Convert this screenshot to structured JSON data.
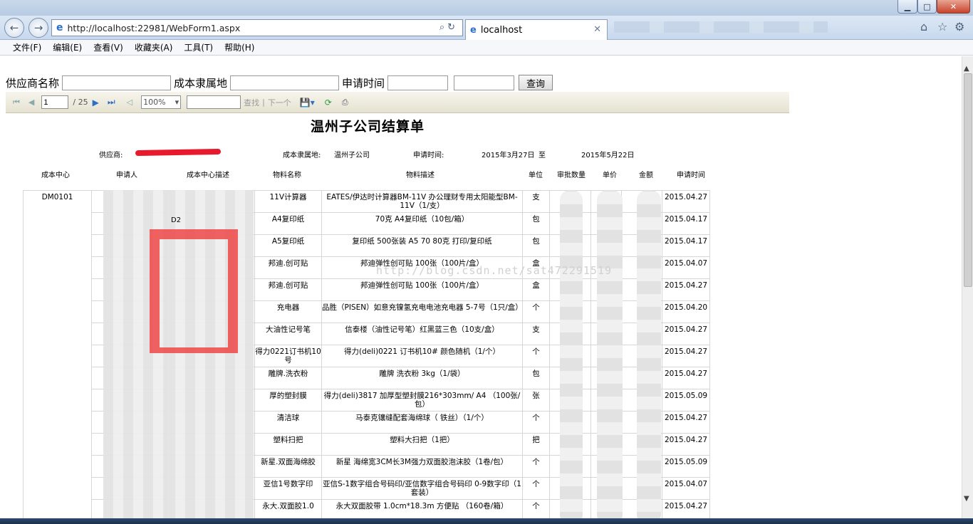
{
  "browser": {
    "address": "http://localhost:22981/WebForm1.aspx",
    "tab_title": "localhost"
  },
  "menu": [
    "文件(F)",
    "编辑(E)",
    "查看(V)",
    "收藏夹(A)",
    "工具(T)",
    "帮助(H)"
  ],
  "search": {
    "supplier_label": "供应商名称",
    "cost_label": "成本隶属地",
    "date_label": "申请时间",
    "query_label": "查询"
  },
  "report_toolbar": {
    "page_value": "1",
    "page_total": "/ 25",
    "zoom": "100%",
    "find_label": "查找",
    "separator": "|",
    "next_label": "下一个"
  },
  "report": {
    "title": "温州子公司结算单",
    "supplier_label": "供应商:",
    "cost_label": "成本隶属地:",
    "cost_value": "温州子公司",
    "date_label": "申请时间:",
    "date_from": "2015年3月27日",
    "date_sep": "至",
    "date_to": "2015年5月22日",
    "columns": [
      "成本中心",
      "申请人",
      "成本中心描述",
      "物料名称",
      "物料描述",
      "单位",
      "审批数量",
      "单价",
      "金额",
      "申请时间"
    ],
    "cost_center": "DM0101",
    "fragment_d2": "D2",
    "rows": [
      {
        "name": "11V计算器",
        "desc": "EATES/伊达时计算器BM-11V 办公理财专用太阳能型BM-11V（1/支）",
        "unit": "支",
        "date": "2015.04.27"
      },
      {
        "name": "A4复印纸",
        "desc": "70克 A4复印纸（10包/箱）",
        "unit": "包",
        "date": "2015.04.17"
      },
      {
        "name": "A5复印纸",
        "desc": "复印纸 500张装 A5 70 80克 打印/复印纸",
        "unit": "包",
        "date": "2015.04.17"
      },
      {
        "name": "邦迪.创可贴",
        "desc": "邦迪弹性创可贴 100张（100片/盒）",
        "unit": "盒",
        "date": "2015.04.07"
      },
      {
        "name": "邦迪.创可贴",
        "desc": "邦迪弹性创可贴 100张（100片/盒）",
        "unit": "盒",
        "date": "2015.04.27"
      },
      {
        "name": "充电器",
        "desc": "品胜（PISEN）如意充镍氢充电电池充电器 5-7号（1只/盒）",
        "unit": "个",
        "date": "2015.04.20"
      },
      {
        "name": "大油性记号笔",
        "desc": "信泰楼（油性记号笔）红黑蓝三色（10支/盒）",
        "unit": "支",
        "date": "2015.04.27"
      },
      {
        "name": "得力0221订书机10号",
        "desc": "得力(deli)0221 订书机10# 颜色随机（1/个）",
        "unit": "个",
        "date": "2015.04.27"
      },
      {
        "name": "雕牌.洗衣粉",
        "desc": "雕牌 洗衣粉 3kg（1/袋）",
        "unit": "包",
        "date": "2015.04.27"
      },
      {
        "name": "厚的塑封膜",
        "desc": "得力(deli)3817 加厚型塑封膜216*303mm/ A4 （100张/包）",
        "unit": "张",
        "date": "2015.05.09"
      },
      {
        "name": "清洁球",
        "desc": "马泰克镶缝配套海绵球（ 铁丝）（1/个）",
        "unit": "个",
        "date": "2015.04.27"
      },
      {
        "name": "塑料扫把",
        "desc": "塑料大扫把（1把）",
        "unit": "把",
        "date": "2015.04.27"
      },
      {
        "name": "新星.双面海绵胶",
        "desc": "新星 海绵宽3CM长3M强力双面胶泡沫胶（1卷/包）",
        "unit": "个",
        "date": "2015.05.09"
      },
      {
        "name": "亚信1号数字印",
        "desc": "亚信S-1数字组合号码印/亚信数字组合号码印 0-9数字印（1套装）",
        "unit": "个",
        "date": "2015.04.07"
      },
      {
        "name": "永大.双面胶1.0",
        "desc": "永大双面胶带 1.0cm*18.3m 方便贴 （160卷/箱）",
        "unit": "个",
        "date": "2015.04.27"
      }
    ]
  },
  "watermark": "http://blog.csdn.net/sat472291519",
  "icons": [
    "back-arrow-icon",
    "forward-arrow-icon",
    "ie-logo-icon",
    "search-icon",
    "refresh-icon",
    "close-icon",
    "home-icon",
    "star-icon",
    "gear-icon",
    "first-page-icon",
    "prev-page-icon",
    "next-page-icon",
    "last-page-icon",
    "back-report-icon",
    "export-icon",
    "refresh-report-icon",
    "print-icon"
  ]
}
